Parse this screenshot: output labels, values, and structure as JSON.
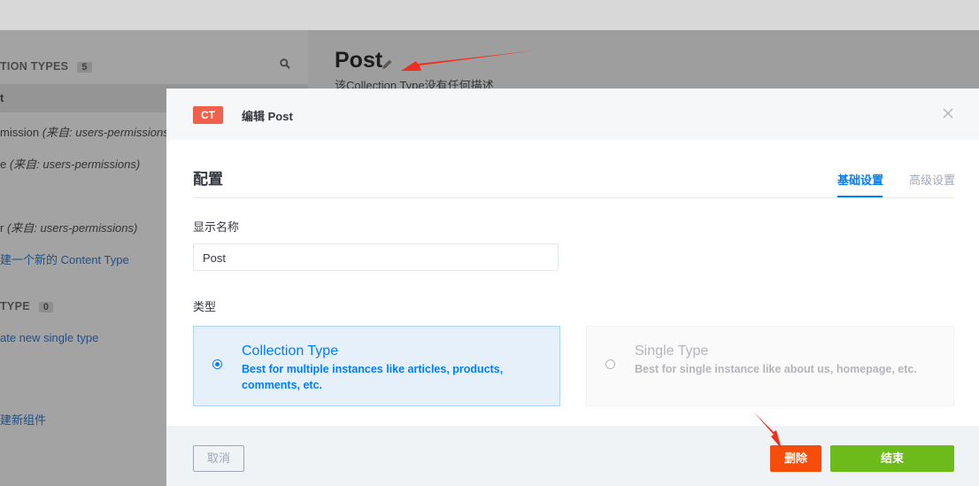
{
  "sidebar": {
    "collection_section": {
      "title": "TION TYPES",
      "count": "5"
    },
    "collection_items": [
      {
        "name": "t",
        "from": ""
      },
      {
        "name": "mission ",
        "from": "(来自: users-permissions)"
      },
      {
        "name": "e ",
        "from": "(来自: users-permissions)"
      },
      {
        "name": "",
        "from": ""
      },
      {
        "name": "r ",
        "from": "(来自: users-permissions)"
      }
    ],
    "create_content_type_link": "建一个新的 Content Type",
    "single_section": {
      "title": "TYPE",
      "count": "0"
    },
    "create_single_type_link": "ate new single type",
    "create_component_link": "建新组件"
  },
  "page": {
    "title": "Post",
    "subtitle": "该Collection Type没有任何描述"
  },
  "modal": {
    "badge": "CT",
    "title": "编辑 Post",
    "section_title": "配置",
    "tabs": {
      "basic": "基础设置",
      "advanced": "高级设置"
    },
    "display_name_label": "显示名称",
    "display_name_value": "Post",
    "type_label": "类型",
    "types": {
      "collection": {
        "title": "Collection Type",
        "description": "Best for multiple instances like articles, products, comments, etc.",
        "selected": true
      },
      "single": {
        "title": "Single Type",
        "description": "Best for single instance like about us, homepage, etc.",
        "selected": false
      }
    },
    "footer": {
      "cancel": "取消",
      "delete": "删除",
      "finish": "结束"
    }
  },
  "colors": {
    "accent": "#007eff",
    "badge": "#f0604a",
    "delete": "#f64d0a",
    "finish": "#6dbb1a",
    "annotation_arrow": "#f0301e"
  },
  "icons": [
    "search-icon",
    "pencil-icon",
    "close-icon",
    "radio-selected-icon",
    "radio-unselected-icon"
  ]
}
